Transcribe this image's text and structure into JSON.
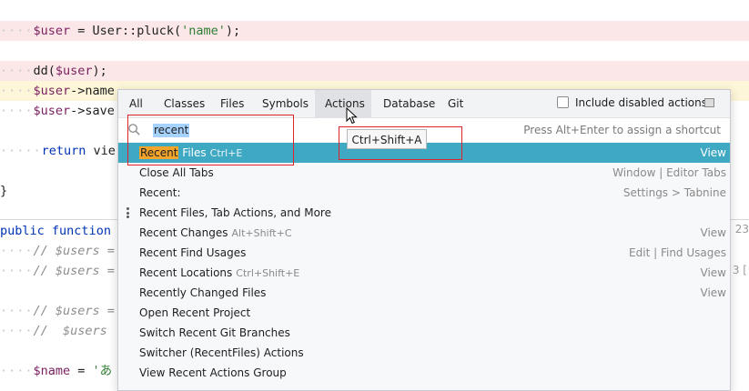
{
  "editor": {
    "lines": [
      {
        "id": "user-pluck",
        "kind": "pink",
        "segments": [
          [
            "dots",
            "····"
          ],
          [
            "var",
            "$user"
          ],
          [
            "txt",
            " = User::pluck("
          ],
          [
            "str",
            "'name'"
          ],
          [
            "txt",
            ");"
          ]
        ]
      },
      {
        "id": "dd-user",
        "kind": "pink",
        "segments": [
          [
            "dots",
            "····"
          ],
          [
            "txt",
            "dd("
          ],
          [
            "var",
            "$user"
          ],
          [
            "txt",
            ");"
          ]
        ]
      },
      {
        "id": "user-name",
        "kind": "yellow",
        "segments": [
          [
            "dots",
            "····"
          ],
          [
            "var",
            "$user"
          ],
          [
            "txt",
            "->name"
          ]
        ]
      },
      {
        "id": "user-save",
        "kind": "plain",
        "segments": [
          [
            "dots",
            "····"
          ],
          [
            "var",
            "$user"
          ],
          [
            "txt",
            "->save"
          ]
        ]
      },
      {
        "id": "return-view",
        "kind": "plain",
        "segments": [
          [
            "dots",
            "·····"
          ],
          [
            "kw",
            "return"
          ],
          [
            "txt",
            " vie"
          ]
        ]
      },
      {
        "id": "close-brace",
        "kind": "plain",
        "segments": [
          [
            "txt",
            "}"
          ]
        ]
      },
      {
        "id": "public-function",
        "kind": "plain",
        "segments": [
          [
            "kw",
            "public"
          ],
          [
            "txt",
            " "
          ],
          [
            "kw",
            "function"
          ]
        ]
      },
      {
        "id": "comment-users-1",
        "kind": "plain",
        "segments": [
          [
            "dots",
            "····"
          ],
          [
            "cmt",
            "// $users ="
          ]
        ]
      },
      {
        "id": "comment-users-2",
        "kind": "plain",
        "segments": [
          [
            "dots",
            "····"
          ],
          [
            "cmt",
            "// $users ="
          ]
        ]
      },
      {
        "id": "comment-users-3",
        "kind": "plain",
        "segments": [
          [
            "dots",
            "····"
          ],
          [
            "cmt",
            "// $users ="
          ]
        ]
      },
      {
        "id": "comment-users-4",
        "kind": "plain",
        "segments": [
          [
            "dots",
            "····"
          ],
          [
            "cmt",
            "//  $users"
          ]
        ]
      },
      {
        "id": "name-assign",
        "kind": "plain",
        "segments": [
          [
            "dots",
            "····"
          ],
          [
            "var",
            "$name"
          ],
          [
            "txt",
            " = "
          ],
          [
            "str",
            "'あ"
          ]
        ]
      }
    ],
    "right_gutter_number": "23",
    "right_gutter_bracket": "3 ["
  },
  "popup": {
    "tabs": [
      {
        "label": "All",
        "active": false
      },
      {
        "label": "Classes",
        "active": false
      },
      {
        "label": "Files",
        "active": false
      },
      {
        "label": "Symbols",
        "active": false
      },
      {
        "label": "Actions",
        "active": true
      },
      {
        "label": "Database",
        "active": false
      },
      {
        "label": "Git",
        "active": false
      }
    ],
    "include_disabled_label": "Include disabled actions",
    "include_disabled_checked": false,
    "search": {
      "value": "recent",
      "hint": "Press Alt+Enter to assign a shortcut"
    },
    "results": [
      {
        "highlight": "Recent",
        "name": " Files",
        "shortcut": "Ctrl+E",
        "category": "View",
        "selected": true
      },
      {
        "highlight": "",
        "name": "Close All Tabs",
        "shortcut": "",
        "category": "Window | Editor Tabs",
        "selected": false
      },
      {
        "highlight": "",
        "name": "Recent:",
        "shortcut": "",
        "category": "Settings > Tabnine",
        "selected": false
      },
      {
        "highlight": "",
        "name": "Recent Files, Tab Actions, and More",
        "shortcut": "",
        "category": "",
        "selected": false,
        "kebab": true
      },
      {
        "highlight": "",
        "name": "Recent Changes",
        "shortcut": "Alt+Shift+C",
        "category": "View",
        "selected": false
      },
      {
        "highlight": "",
        "name": "Recent Find Usages",
        "shortcut": "",
        "category": "Edit | Find Usages",
        "selected": false
      },
      {
        "highlight": "",
        "name": "Recent Locations",
        "shortcut": "Ctrl+Shift+E",
        "category": "View",
        "selected": false
      },
      {
        "highlight": "",
        "name": "Recently Changed Files",
        "shortcut": "",
        "category": "View",
        "selected": false
      },
      {
        "highlight": "",
        "name": "Open Recent Project",
        "shortcut": "",
        "category": "",
        "selected": false
      },
      {
        "highlight": "",
        "name": "Switch Recent Git Branches",
        "shortcut": "",
        "category": "",
        "selected": false
      },
      {
        "highlight": "",
        "name": "Switcher (RecentFiles) Actions",
        "shortcut": "",
        "category": "",
        "selected": false
      },
      {
        "highlight": "",
        "name": "View Recent Actions Group",
        "shortcut": "",
        "category": "",
        "selected": false
      }
    ]
  },
  "tooltip": {
    "text": "Ctrl+Shift+A"
  },
  "colors": {
    "selected_row": "#3fa8c2",
    "match_highlight": "#f2a42b",
    "annotation_red": "#e0232a",
    "pink_line": "#fbe7e8"
  }
}
